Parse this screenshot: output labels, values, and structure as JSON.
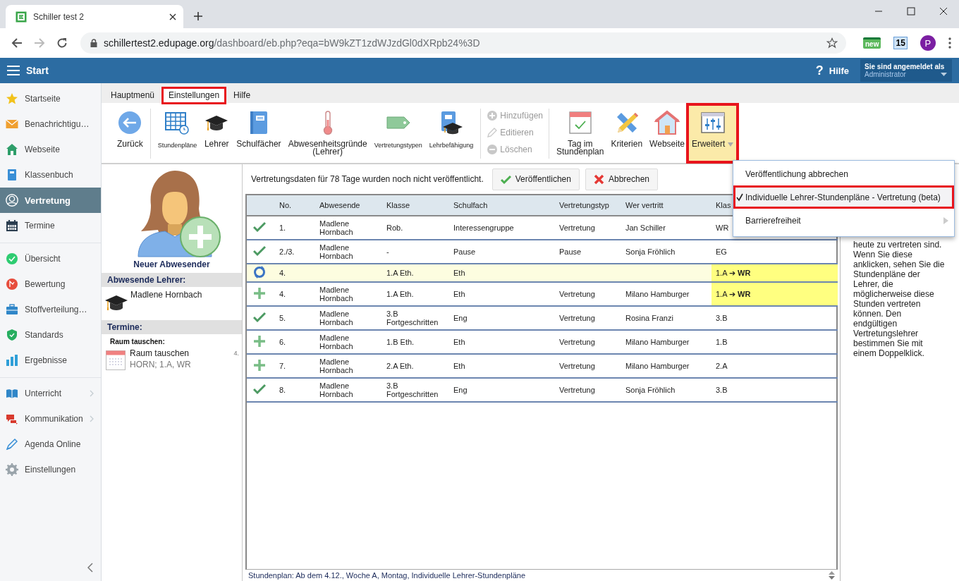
{
  "browser": {
    "tab_title": "Schiller test 2",
    "url_host": "schillertest2.edupage.org",
    "url_path": "/dashboard/eb.php?eqa=bW9kZT1zdWJzdGl0dXRpb24%3D",
    "extensions": [
      "new",
      "15"
    ],
    "profile": "P"
  },
  "app_header": {
    "title": "Start",
    "help_mark": "?",
    "help": "Hilfe",
    "login_label": "Sie sind angemeldet als",
    "login_user": "Administrator"
  },
  "sidebar": {
    "groups": [
      {
        "items": [
          {
            "label": "Startseite",
            "selected": false,
            "has_submenu": false
          },
          {
            "label": "Benachrichtigu…",
            "selected": false,
            "has_submenu": false
          },
          {
            "label": "Webseite",
            "selected": false,
            "has_submenu": false
          },
          {
            "label": "Klassenbuch",
            "selected": false,
            "has_submenu": false
          },
          {
            "label": "Vertretung",
            "selected": true,
            "has_submenu": false
          },
          {
            "label": "Termine",
            "selected": false,
            "has_submenu": false
          }
        ]
      },
      {
        "items": [
          {
            "label": "Übersicht",
            "selected": false,
            "has_submenu": false
          },
          {
            "label": "Bewertung",
            "selected": false,
            "has_submenu": false
          },
          {
            "label": "Stoffverteilung…",
            "selected": false,
            "has_submenu": false
          },
          {
            "label": "Standards",
            "selected": false,
            "has_submenu": false
          },
          {
            "label": "Ergebnisse",
            "selected": false,
            "has_submenu": false
          }
        ]
      },
      {
        "items": [
          {
            "label": "Unterricht",
            "selected": false,
            "has_submenu": true
          },
          {
            "label": "Kommunikation",
            "selected": false,
            "has_submenu": true
          },
          {
            "label": "Agenda Online",
            "selected": false,
            "has_submenu": false
          },
          {
            "label": "Einstellungen",
            "selected": false,
            "has_submenu": false
          }
        ]
      }
    ]
  },
  "menu_tabs": [
    {
      "label": "Hauptmenü",
      "selected": false,
      "highlighted": false
    },
    {
      "label": "Einstellungen",
      "selected": true,
      "highlighted": true
    },
    {
      "label": "Hilfe",
      "selected": false,
      "highlighted": false
    }
  ],
  "toolbar": {
    "groups": [
      {
        "items": [
          {
            "label": "Zurück",
            "kind": "large",
            "disabled": false,
            "open": false,
            "highlighted": false,
            "has_menu": false
          }
        ]
      },
      {
        "items": [
          {
            "label": "Stundenpläne",
            "kind": "small",
            "disabled": false,
            "open": false,
            "highlighted": false,
            "has_menu": false
          },
          {
            "label": "Lehrer",
            "kind": "large",
            "disabled": false,
            "open": false,
            "highlighted": false,
            "has_menu": false
          },
          {
            "label": "Schulfächer",
            "kind": "large",
            "disabled": false,
            "open": false,
            "highlighted": false,
            "has_menu": false
          },
          {
            "label": "Abwesenheitsgründe (Lehrer)",
            "kind": "large",
            "disabled": false,
            "open": false,
            "highlighted": false,
            "has_menu": false
          },
          {
            "label": "Vertretungstypen",
            "kind": "small",
            "disabled": false,
            "open": false,
            "highlighted": false,
            "has_menu": false
          },
          {
            "label": "Lehrbefähigung",
            "kind": "small",
            "disabled": false,
            "open": false,
            "highlighted": false,
            "has_menu": false
          }
        ]
      },
      {
        "items": [
          {
            "label": "Hinzufügen",
            "kind": "compact",
            "disabled": true,
            "open": false,
            "highlighted": false,
            "has_menu": false
          },
          {
            "label": "Editieren",
            "kind": "compact",
            "disabled": true,
            "open": false,
            "highlighted": false,
            "has_menu": false
          },
          {
            "label": "Löschen",
            "kind": "compact",
            "disabled": true,
            "open": false,
            "highlighted": false,
            "has_menu": false
          }
        ]
      },
      {
        "items": [
          {
            "label": "Tag im Stundenplan",
            "kind": "large",
            "disabled": false,
            "open": false,
            "highlighted": false,
            "has_menu": false
          },
          {
            "label": "Kriterien",
            "kind": "large",
            "disabled": false,
            "open": false,
            "highlighted": false,
            "has_menu": false
          },
          {
            "label": "Webseite",
            "kind": "large",
            "disabled": false,
            "open": false,
            "highlighted": false,
            "has_menu": false
          },
          {
            "label": "Erweitert",
            "kind": "large",
            "disabled": false,
            "open": true,
            "highlighted": true,
            "has_menu": true
          }
        ]
      }
    ]
  },
  "absentees": {
    "new_label": "Neuer Abwesender",
    "teachers_heading": "Abwesende Lehrer:",
    "teachers": [
      "Madlene Hornbach"
    ],
    "events_heading": "Termine:",
    "event_groups": [
      {
        "title": "Raum tauschen:",
        "events": [
          {
            "name": "Raum tauschen",
            "details": "HORN; 1.A, WR",
            "period": "4."
          }
        ]
      }
    ]
  },
  "substitutions": {
    "notice": "Vertretungsdaten für 78 Tage wurden noch nicht veröffentlicht.",
    "actions": [
      {
        "label": "Veröffentlichen",
        "kind": "publish"
      },
      {
        "label": "Abbrechen",
        "kind": "cancel"
      }
    ],
    "columns": [
      "No.",
      "Abwesende",
      "Klasse",
      "Schulfach",
      "Vertretungstyp",
      "Wer vertritt",
      "Klas"
    ],
    "rows": [
      {
        "kind": "done",
        "selected": false,
        "marked": false,
        "cells": {
          "no": "1.",
          "absent": "Madlene Hornbach",
          "class": "Rob.",
          "subject": "Interessengruppe",
          "type": "Vertretung",
          "substitute": "Jan Schiller",
          "column_8": "WR"
        }
      },
      {
        "kind": "done",
        "selected": false,
        "marked": false,
        "cells": {
          "no": "2./3.",
          "absent": "Madlene Hornbach",
          "class": "-",
          "subject": "Pause",
          "type": "Pause",
          "substitute": "Sonja Fröhlich",
          "column_8": "EG"
        }
      },
      {
        "kind": "sync",
        "selected": true,
        "marked": true,
        "cells": {
          "no": "4.",
          "class": "1.A Eth.",
          "subject": "Eth",
          "column_8": "1.A ➔ **WR**"
        }
      },
      {
        "kind": "new",
        "selected": false,
        "marked": true,
        "cells": {
          "no": "4.",
          "absent": "Madlene Hornbach",
          "class": "1.A Eth.",
          "subject": "Eth",
          "type": "Vertretung",
          "substitute": "Milano Hamburger",
          "column_8": "1.A ➔ **WR**"
        }
      },
      {
        "kind": "done",
        "selected": false,
        "marked": false,
        "cells": {
          "no": "5.",
          "absent": "Madlene Hornbach",
          "class": "3.B Fortgeschritten",
          "subject": "Eng",
          "type": "Vertretung",
          "substitute": "Rosina Franzi",
          "column_8": "3.B"
        }
      },
      {
        "kind": "new",
        "selected": false,
        "marked": false,
        "cells": {
          "no": "6.",
          "absent": "Madlene Hornbach",
          "class": "1.B Eth.",
          "subject": "Eth",
          "type": "Vertretung",
          "substitute": "Milano Hamburger",
          "column_8": "1.B"
        }
      },
      {
        "kind": "new",
        "selected": false,
        "marked": false,
        "cells": {
          "no": "7.",
          "absent": "Madlene Hornbach",
          "class": "2.A Eth.",
          "subject": "Eth",
          "type": "Vertretung",
          "substitute": "Milano Hamburger",
          "column_8": "2.A"
        }
      },
      {
        "kind": "done",
        "selected": false,
        "marked": false,
        "cells": {
          "no": "8.",
          "absent": "Madlene Hornbach",
          "class": "3.B Fortgeschritten",
          "subject": "Eng",
          "type": "Vertretung",
          "substitute": "Sonja Fröhlich",
          "column_8": "3.B"
        }
      }
    ],
    "status_bar": "Stundenplan: Ab dem 4.12., Woche A, Montag, Individuelle Lehrer-Stundenpläne"
  },
  "help_text": "heute zu vertreten sind. Wenn Sie diese anklicken, sehen Sie die Stundenpläne der Lehrer, die möglicherweise diese Stunden vertreten können. Den endgültigen Vertretungslehrer bestimmen Sie mit einem Doppelklick.",
  "dropdown": {
    "items": [
      {
        "label": "Veröffentlichung abbrechen",
        "checked": false,
        "highlighted": false,
        "has_submenu": false
      },
      {
        "label": "Individuelle Lehrer-Stundenpläne - Vertretung (beta)",
        "checked": true,
        "highlighted": true,
        "has_submenu": false
      },
      {
        "label": "Barrierefreiheit",
        "checked": false,
        "highlighted": false,
        "has_submenu": true
      }
    ]
  }
}
